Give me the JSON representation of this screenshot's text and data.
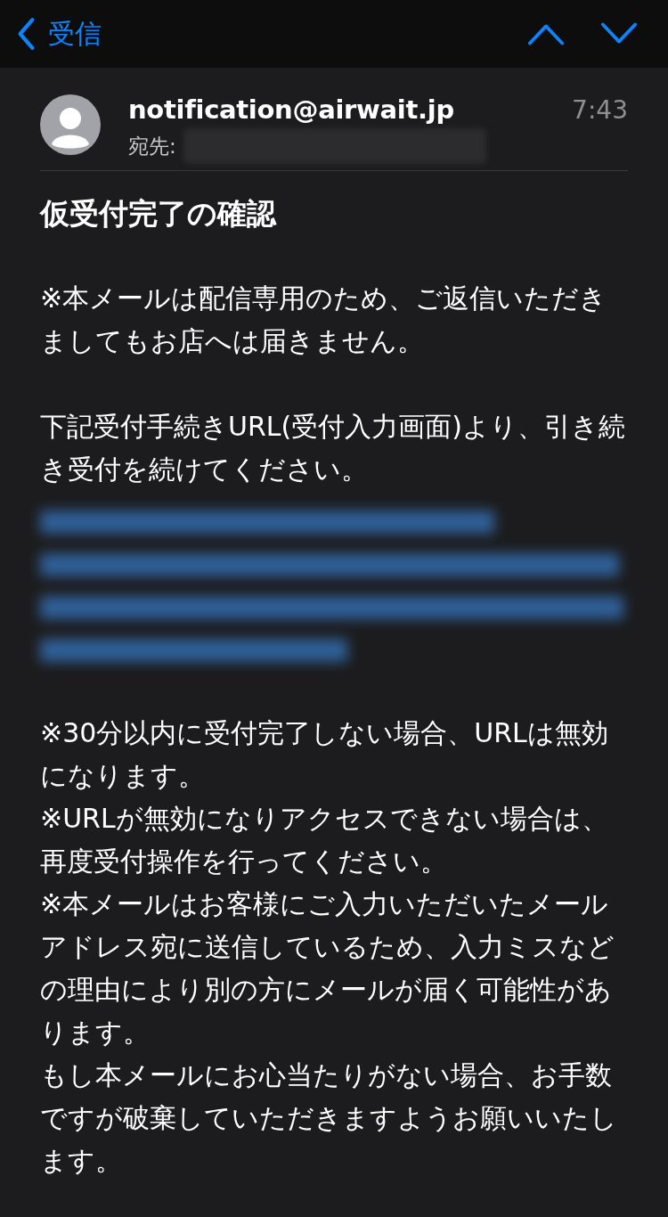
{
  "nav": {
    "back_label": "受信"
  },
  "message": {
    "sender": "notification@airwait.jp",
    "recipient_label": "宛先:",
    "time": "7:43",
    "subject": "仮受付完了の確認",
    "body": [
      {
        "kind": "paragraph",
        "text": "※本メールは配信専用のため、ご返信いただきましてもお店へは届きません。"
      },
      {
        "kind": "lead",
        "text": "下記受付手続きURL(受付入力画面)より、引き続き受付を続けてください。"
      },
      {
        "kind": "redacted_link"
      },
      {
        "kind": "note",
        "text": "※30分以内に受付完了しない場合、URLは無効になります。"
      },
      {
        "kind": "note",
        "text": "※URLが無効になりアクセスできない場合は、再度受付操作を行ってください。"
      },
      {
        "kind": "note",
        "text": "※本メールはお客様にご入力いただいたメールアドレス宛に送信しているため、入力ミスなどの理由により別の方にメールが届く可能性があります。"
      },
      {
        "kind": "note",
        "text": "もし本メールにお心当たりがない場合、お手数ですが破棄していただきますようお願いいたします。"
      }
    ]
  }
}
